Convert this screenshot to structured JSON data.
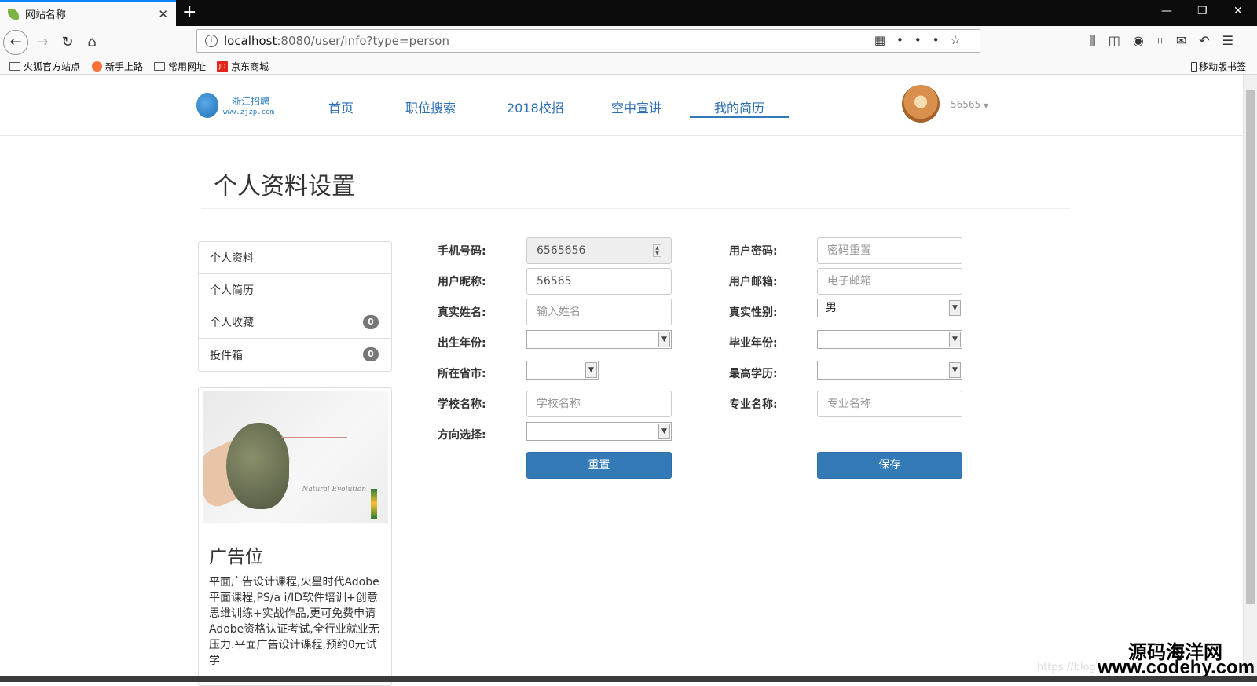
{
  "browser": {
    "tab_title": "网站名称",
    "url_host": "localhost",
    "url_rest": ":8080/user/info?type=person",
    "bookmarks": [
      "火狐官方站点",
      "新手上路",
      "常用网址",
      "京东商城"
    ],
    "mobile_bookmarks": "移动版书签"
  },
  "site": {
    "logo_text": "浙江招聘",
    "logo_url": "www.zjzp.com",
    "nav": [
      "首页",
      "职位搜索",
      "2018校招",
      "空中宣讲",
      "我的简历"
    ],
    "username": "56565"
  },
  "page": {
    "title": "个人资料设置"
  },
  "sidebar": {
    "items": [
      {
        "label": "个人资料"
      },
      {
        "label": "个人简历"
      },
      {
        "label": "个人收藏",
        "badge": "0"
      },
      {
        "label": "投件箱",
        "badge": "0"
      }
    ]
  },
  "ad": {
    "image_brand": "Natural Evolution",
    "title": "广告位",
    "text": "平面广告设计课程,火星时代Adobe平面课程,PS/a i/ID软件培训+创意思维训练+实战作品,更可免费申请Adobe资格认证考试,全行业就业无压力.平面广告设计课程,预约0元试学"
  },
  "form": {
    "phone_label": "手机号码:",
    "phone_value": "6565656",
    "password_label": "用户密码:",
    "password_placeholder": "密码重置",
    "nickname_label": "用户昵称:",
    "nickname_value": "56565",
    "email_label": "用户邮箱:",
    "email_placeholder": "电子邮箱",
    "realname_label": "真实姓名:",
    "realname_placeholder": "输入姓名",
    "gender_label": "真实性别:",
    "gender_value": "男",
    "birth_label": "出生年份:",
    "grad_label": "毕业年份:",
    "province_label": "所在省市:",
    "education_label": "最高学历:",
    "school_label": "学校名称:",
    "school_placeholder": "学校名称",
    "major_label": "专业名称:",
    "major_placeholder": "专业名称",
    "direction_label": "方向选择:",
    "reset_label": "重置",
    "save_label": "保存"
  },
  "watermark": {
    "cn": "源码海洋网",
    "url": "www.codehy.com",
    "faint": "https://blog"
  }
}
